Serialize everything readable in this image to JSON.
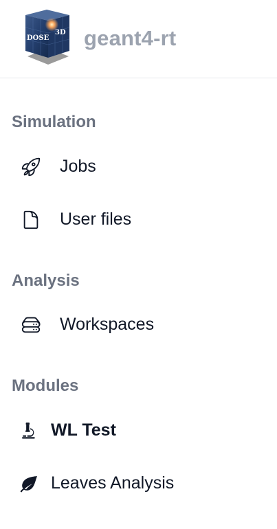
{
  "brand": {
    "logo_text_left": "DOSE",
    "logo_text_right": "3D",
    "name": "geant4-rt"
  },
  "sections": [
    {
      "title": "Simulation",
      "items": [
        {
          "label": "Jobs",
          "icon": "rocket-icon"
        },
        {
          "label": "User files",
          "icon": "file-icon"
        }
      ]
    },
    {
      "title": "Analysis",
      "items": [
        {
          "label": "Workspaces",
          "icon": "server-stack-icon"
        }
      ]
    },
    {
      "title": "Modules",
      "items": [
        {
          "label": "WL Test",
          "icon": "microscope-icon",
          "active": true
        },
        {
          "label": "Leaves Analysis",
          "icon": "leaf-icon"
        }
      ]
    }
  ],
  "colors": {
    "brand_text": "#9ca3af",
    "section_title": "#6b7280",
    "item_text": "#111827",
    "divider": "#e5e7eb"
  }
}
